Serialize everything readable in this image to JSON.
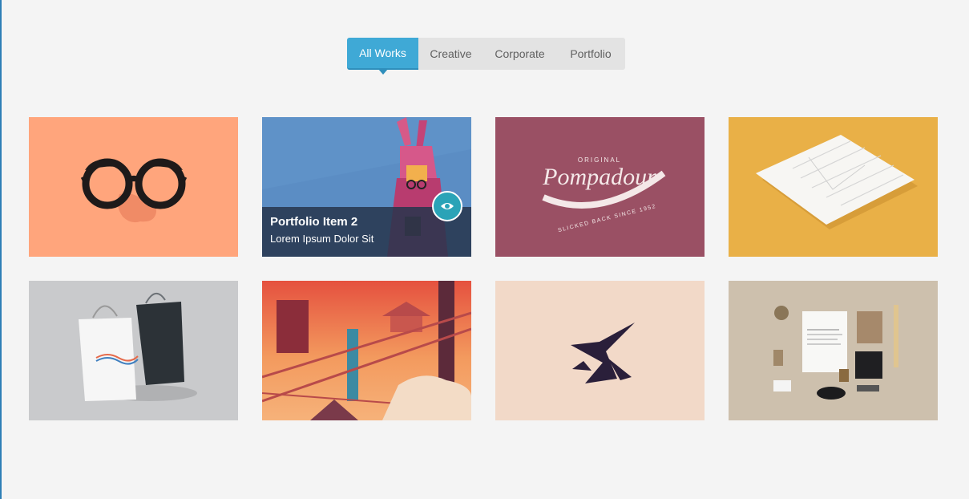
{
  "filters": {
    "tabs": [
      {
        "label": "All Works",
        "active": true
      },
      {
        "label": "Creative",
        "active": false
      },
      {
        "label": "Corporate",
        "active": false
      },
      {
        "label": "Portfolio",
        "active": false
      }
    ]
  },
  "portfolio": {
    "items": [
      {
        "icon": "glasses-mask-image",
        "background": "#ffa57c"
      },
      {
        "icon": "rabbit-costume-image",
        "background": "#5b8dc4",
        "hover": {
          "title": "Portfolio Item 2",
          "subtitle": "Lorem Ipsum Dolor Sit"
        }
      },
      {
        "icon": "pompadour-logo-image",
        "background": "#9a5064",
        "logo_text": {
          "top": "ORIGINAL",
          "main": "Pompadour",
          "bottom": "SLICKED BACK SINCE 1952"
        }
      },
      {
        "icon": "stationery-paper-image",
        "background": "#e9b047"
      },
      {
        "icon": "shopping-bags-image",
        "background": "#c9cacc"
      },
      {
        "icon": "city-illustration-image",
        "background": "#e3704f"
      },
      {
        "icon": "abstract-logo-image",
        "background": "#f2d9c8"
      },
      {
        "icon": "branding-mockup-image",
        "background": "#cdc0ad"
      }
    ]
  },
  "colors": {
    "accent": "#3fa9d6",
    "page_background": "#f4f4f4",
    "overlay": "#26354d",
    "eye_button": "#2aa3b7"
  }
}
